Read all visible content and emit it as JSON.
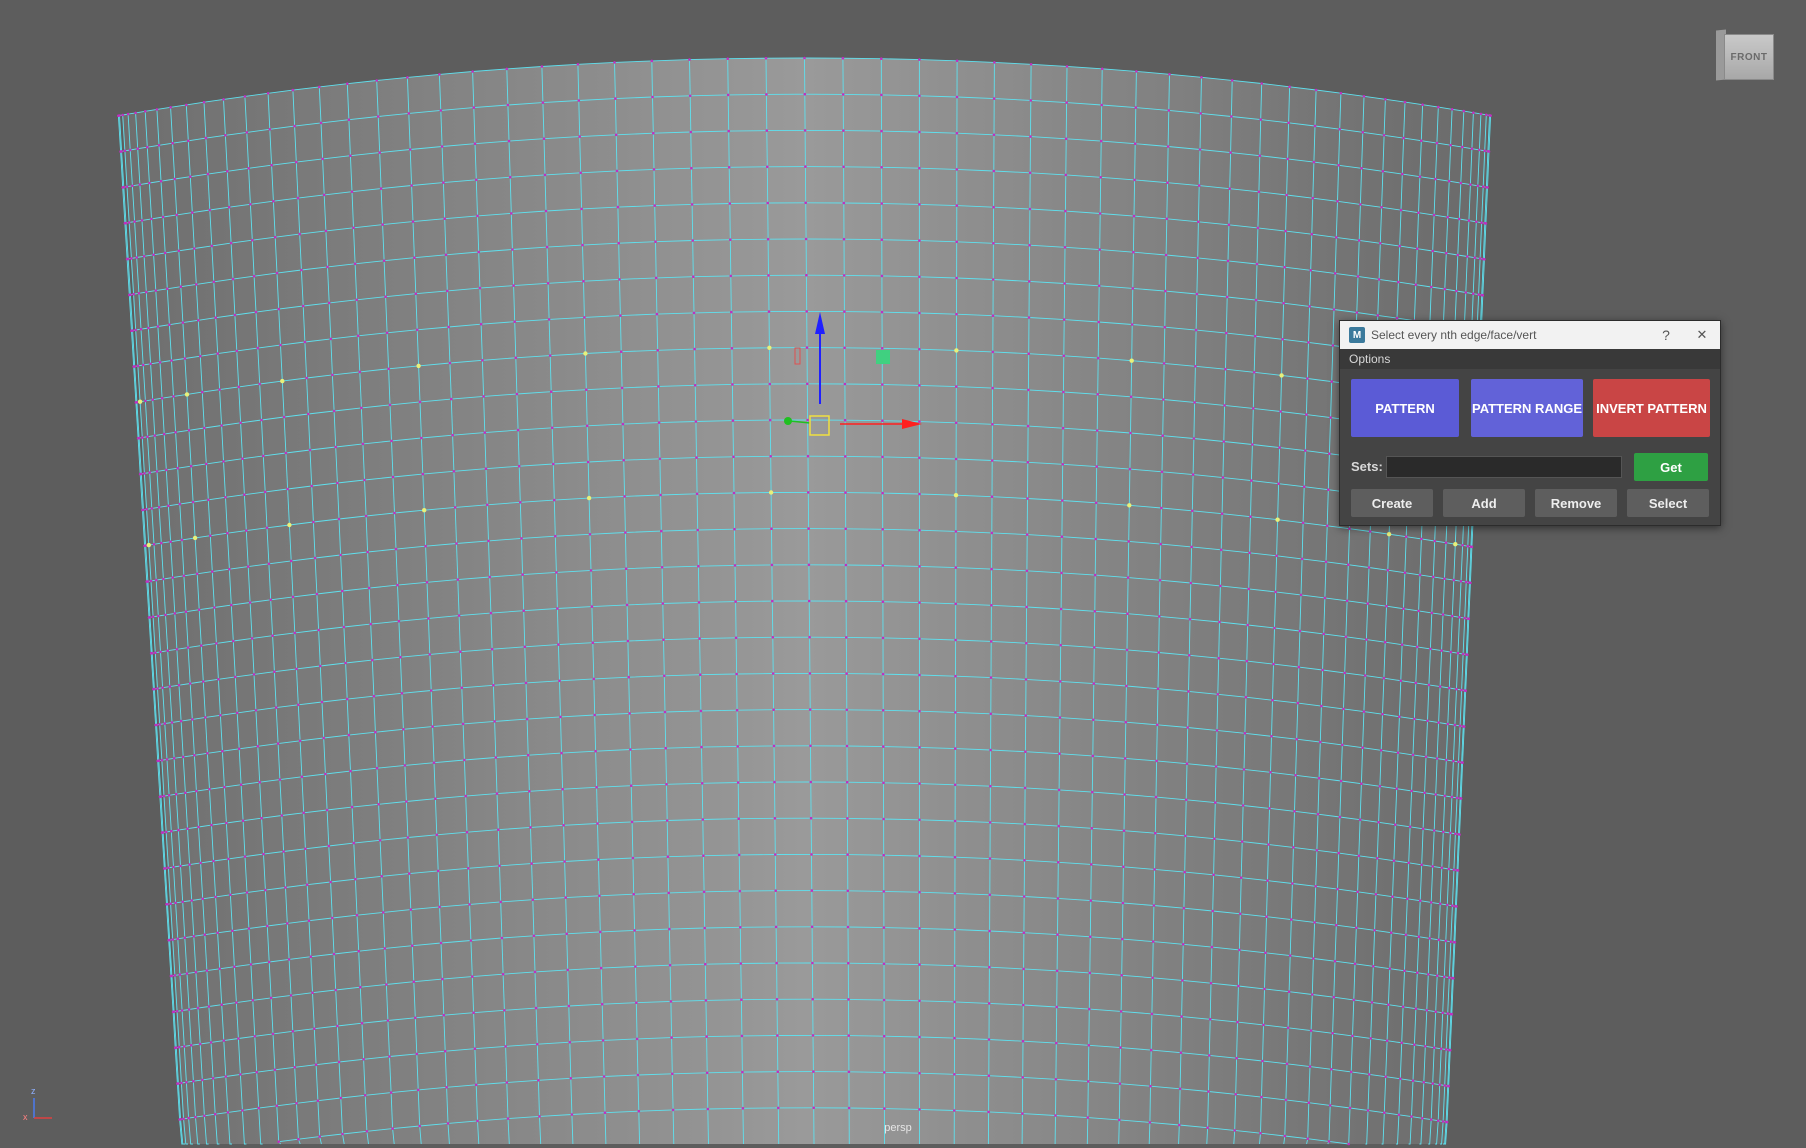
{
  "viewport": {
    "camera_label": "persp",
    "view_cube_label": "FRONT",
    "axis_labels": {
      "y": "z",
      "x": "x"
    },
    "colors": {
      "background": "#5d5d5d",
      "mesh_fill": "#9a9a9a",
      "wire": "#5fe0ee",
      "vertex": "#c02fc0",
      "selected_vertex": "#e8f07a"
    }
  },
  "dialog": {
    "title": "Select every nth edge/face/vert",
    "help_label": "?",
    "close_label": "✕",
    "app_icon_label": "M",
    "menu": [
      "Options"
    ],
    "buttons": {
      "pattern": "PATTERN",
      "pattern_range": "PATTERN RANGE",
      "invert_pattern": "INVERT PATTERN",
      "get": "Get",
      "create": "Create",
      "add": "Add",
      "remove": "Remove",
      "select": "Select"
    },
    "sets": {
      "label": "Sets:",
      "value": ""
    },
    "colors": {
      "pattern": "#5b5bd6",
      "pattern_range": "#6262d8",
      "invert_pattern": "#c94545",
      "get": "#2ea043"
    }
  }
}
